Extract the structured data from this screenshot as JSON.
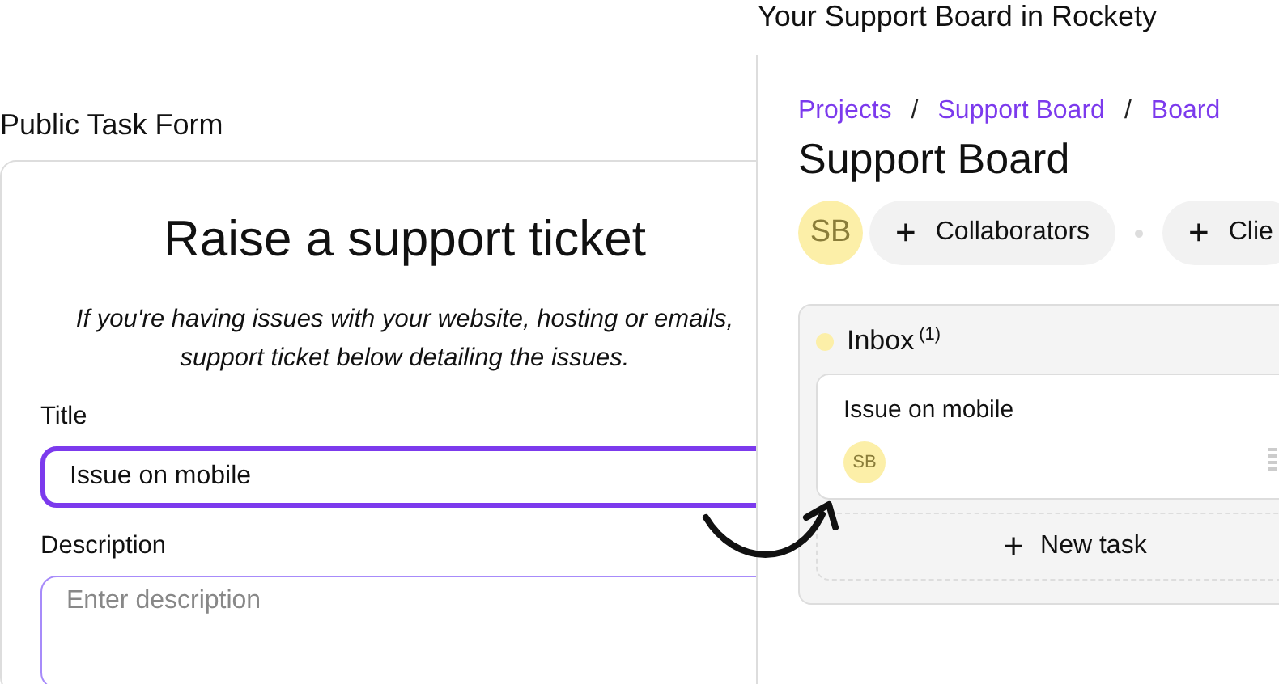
{
  "form_window": {
    "title": "Public Task Form",
    "heading": "Raise a support ticket",
    "intro": [
      "If you're having issues with your website, hosting or emails,",
      "support ticket below detailing the issues."
    ],
    "fields": [
      {
        "label": "Title",
        "value": "Issue on mobile",
        "focused": true
      },
      {
        "label": "Description",
        "placeholder": "Enter description",
        "focused": false
      }
    ]
  },
  "board_window": {
    "title": "Your Support Board in Rockety",
    "breadcrumbs": [
      {
        "kind": "link",
        "label": "Projects"
      },
      {
        "kind": "separator",
        "label": "/"
      },
      {
        "kind": "link",
        "label": "Support Board"
      },
      {
        "kind": "separator",
        "label": "/"
      },
      {
        "kind": "link",
        "label": "Board"
      }
    ],
    "heading": "Support Board",
    "avatar": "SB",
    "buttons": [
      {
        "icon": "+",
        "label": "Collaborators"
      },
      {
        "icon": "+",
        "label": "Clie"
      }
    ],
    "column": {
      "name": "Inbox",
      "count": "(1)",
      "color": "#fcefa8",
      "tasks": [
        {
          "title": "Issue on mobile",
          "assignee": "SB"
        }
      ],
      "add_button": {
        "icon": "+",
        "label": "New task"
      }
    }
  }
}
